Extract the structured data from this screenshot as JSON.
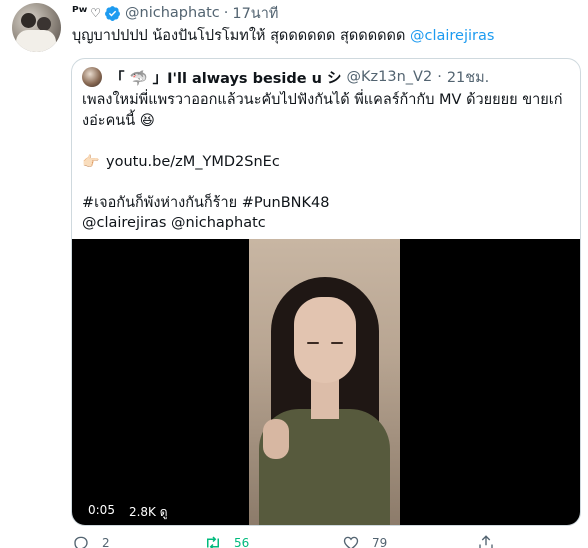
{
  "tweet": {
    "display_name": "ᴾʷ",
    "name_emoji": "♡",
    "handle": "@nichaphatc",
    "separator": "·",
    "time": "17นาที",
    "text_prefix": "บุญบาปปปป น้องปันโปรโมทให้ สุดดดดดด สุดดดดดด",
    "text_mention": "@clairejiras"
  },
  "quote": {
    "display_name": "「 🦈 」I'll always beside u シ",
    "handle": "@Kz13n_V2",
    "separator": "·",
    "time": "21ชม.",
    "line1": "เพลงใหม่พี่แพรวาออกแล้วนะคับไปฟังกันได้ พี่แคลร์ก้ากับ MV ด้วยยยย ขายเก่",
    "line2": "งอ่ะคนนี้ 😆",
    "link_emoji": "👉🏻",
    "link": "youtu.be/zM_YMD2SnEc",
    "hashtags": "#เจอกันก็พังห่างกันก็ร้าย #PunBNK48",
    "mentions": "@clairejiras @nichaphatc",
    "video_time": "0:05",
    "video_views": "2.8K ดู"
  },
  "actions": {
    "reply_count": "2",
    "retweet_count": "56",
    "like_count": "79",
    "share_label": ""
  },
  "icons": {
    "verified": "verified-badge-icon",
    "reply": "reply-icon",
    "retweet": "retweet-icon",
    "like": "heart-icon",
    "share": "share-icon"
  },
  "colors": {
    "accent": "#1d9bf0",
    "muted": "#536471",
    "retweet_active": "#00ba7c",
    "border": "#cfd9de"
  }
}
